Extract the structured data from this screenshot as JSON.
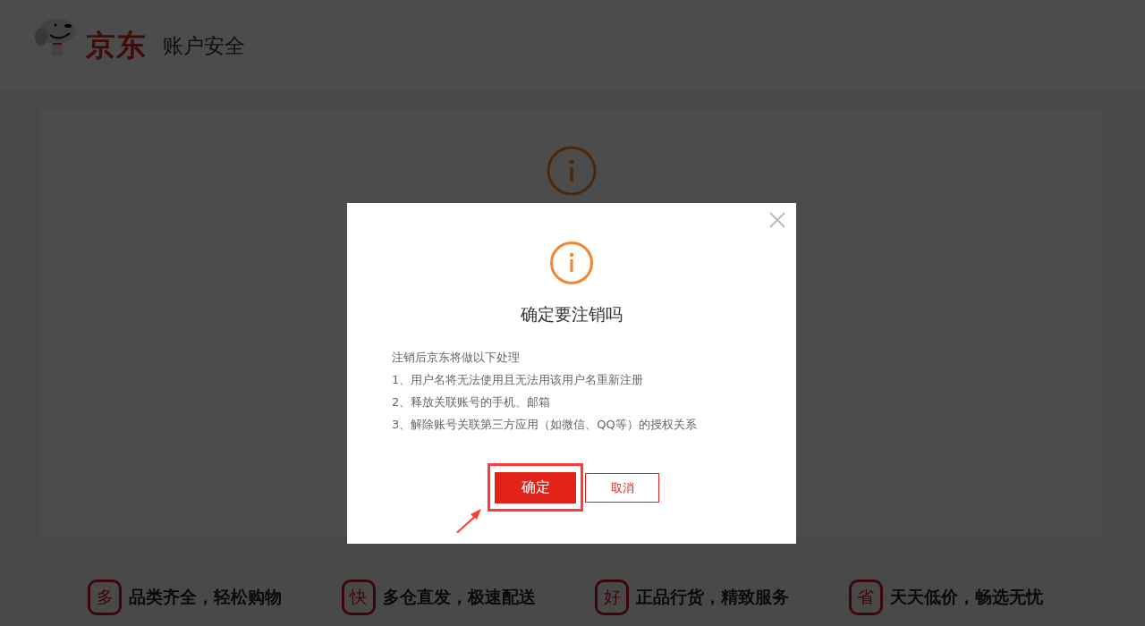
{
  "header": {
    "brand": "京东",
    "title": "账户安全"
  },
  "dialog": {
    "title": "确定要注销吗",
    "intro": "注销后京东将做以下处理",
    "items": [
      "1、用户名将无法使用且无法用该用户名重新注册",
      "2、释放关联账号的手机、邮箱",
      "3、解除账号关联第三方应用（如微信、QQ等）的授权关系"
    ],
    "buttons": [
      {
        "label": "确定",
        "kind": "primary",
        "highlighted": true
      },
      {
        "label": "取消",
        "kind": "secondary",
        "highlighted": false
      }
    ]
  },
  "features": [
    {
      "badge": "多",
      "text": "品类齐全，轻松购物"
    },
    {
      "badge": "快",
      "text": "多仓直发，极速配送"
    },
    {
      "badge": "好",
      "text": "正品行货，精致服务"
    },
    {
      "badge": "省",
      "text": "天天低价，畅选无忧"
    }
  ]
}
